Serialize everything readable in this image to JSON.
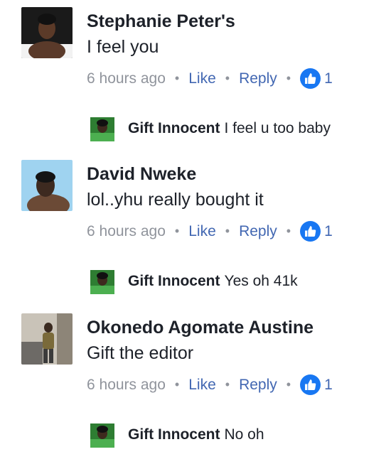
{
  "comments": [
    {
      "author": "Stephanie Peter's",
      "text": "I feel you",
      "time": "6 hours ago",
      "like_label": "Like",
      "reply_label": "Reply",
      "like_count": "1",
      "reply": {
        "author": "Gift Innocent",
        "text": "I feel u too baby"
      }
    },
    {
      "author": "David Nweke",
      "text": "lol..yhu really bought it",
      "time": "6 hours ago",
      "like_label": "Like",
      "reply_label": "Reply",
      "like_count": "1",
      "reply": {
        "author": "Gift Innocent",
        "text": "Yes oh 41k"
      }
    },
    {
      "author": "Okonedo Agomate Austine",
      "text": "Gift the editor",
      "time": "6 hours ago",
      "like_label": "Like",
      "reply_label": "Reply",
      "like_count": "1",
      "reply": {
        "author": "Gift Innocent",
        "text": "No oh"
      }
    }
  ],
  "separator": "•",
  "icons": {
    "like_badge": "thumbs-up-icon"
  },
  "colors": {
    "link": "#4267b2",
    "meta": "#90949c",
    "text": "#1d2129",
    "like_badge": "#1877f2"
  }
}
